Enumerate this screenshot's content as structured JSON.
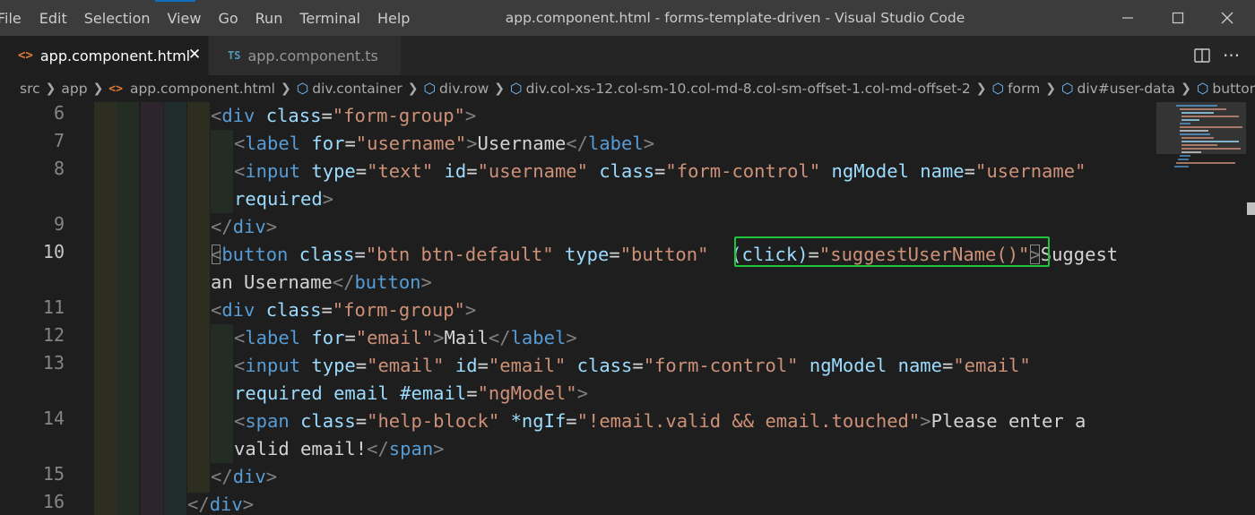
{
  "menu": [
    "File",
    "Edit",
    "Selection",
    "View",
    "Go",
    "Run",
    "Terminal",
    "Help"
  ],
  "window_title": "app.component.html - forms-template-driven - Visual Studio Code",
  "tabs": [
    {
      "icon": "<>",
      "label": "app.component.html",
      "active": true
    },
    {
      "icon": "TS",
      "label": "app.component.ts",
      "active": false
    }
  ],
  "breadcrumb": [
    "src",
    "app",
    "app.component.html",
    "div.container",
    "div.row",
    "div.col-xs-12.col-sm-10.col-md-8.col-sm-offset-1.col-md-offset-2",
    "form",
    "div#user-data",
    "button.b"
  ],
  "line_numbers": {
    "l6": "6",
    "l7": "7",
    "l8": "8",
    "l9": "9",
    "l10": "10",
    "l11": "11",
    "l12": "12",
    "l13": "13",
    "l14": "14",
    "l15": "15",
    "l16": "16"
  },
  "code": {
    "l6": {
      "open": "<",
      "tag": "div",
      "attr": "class",
      "eq": "=",
      "val": "\"form-group\"",
      "close": ">"
    },
    "l7": {
      "tag": "label",
      "attr": "for",
      "val": "\"username\"",
      "text": "Username",
      "ctag": "label"
    },
    "l8": {
      "tag": "input",
      "a1": "type",
      "v1": "\"text\"",
      "a2": "id",
      "v2": "\"username\"",
      "a3": "class",
      "v3": "\"form-control\"",
      "a4": "ngModel",
      "a5": "name",
      "v5": "\"username\""
    },
    "l8b": {
      "a6": "required"
    },
    "l9": {
      "ctag": "div"
    },
    "l10": {
      "tag": "button",
      "a1": "class",
      "v1": "\"btn btn-default\"",
      "a2": "type",
      "v2": "\"button\"",
      "a3": "(click)",
      "v3": "\"suggestUserName()\"",
      "text": "Suggest"
    },
    "l10b": {
      "text": "an Username",
      "ctag": "button"
    },
    "l11": {
      "tag": "div",
      "attr": "class",
      "val": "\"form-group\""
    },
    "l12": {
      "tag": "label",
      "attr": "for",
      "val": "\"email\"",
      "text": "Mail",
      "ctag": "label"
    },
    "l13": {
      "tag": "input",
      "a1": "type",
      "v1": "\"email\"",
      "a2": "id",
      "v2": "\"email\"",
      "a3": "class",
      "v3": "\"form-control\"",
      "a4": "ngModel",
      "a5": "name",
      "v5": "\"email\""
    },
    "l13b": {
      "a6": "required",
      "a7": "email",
      "a8": "#email",
      "v8": "\"ngModel\""
    },
    "l14": {
      "tag": "span",
      "a1": "class",
      "v1": "\"help-block\"",
      "a2": "*ngIf",
      "v2": "\"!email.valid && email.touched\"",
      "text": "Please enter a"
    },
    "l14b": {
      "text": "valid email!",
      "ctag": "span"
    },
    "l15": {
      "ctag": "div"
    },
    "l16": {
      "ctag": "div"
    }
  },
  "colors": {
    "tag": "#569cd6",
    "attr": "#9cdcfe",
    "string": "#ce9178",
    "punct": "#808080",
    "highlight": "#1fc43a"
  }
}
